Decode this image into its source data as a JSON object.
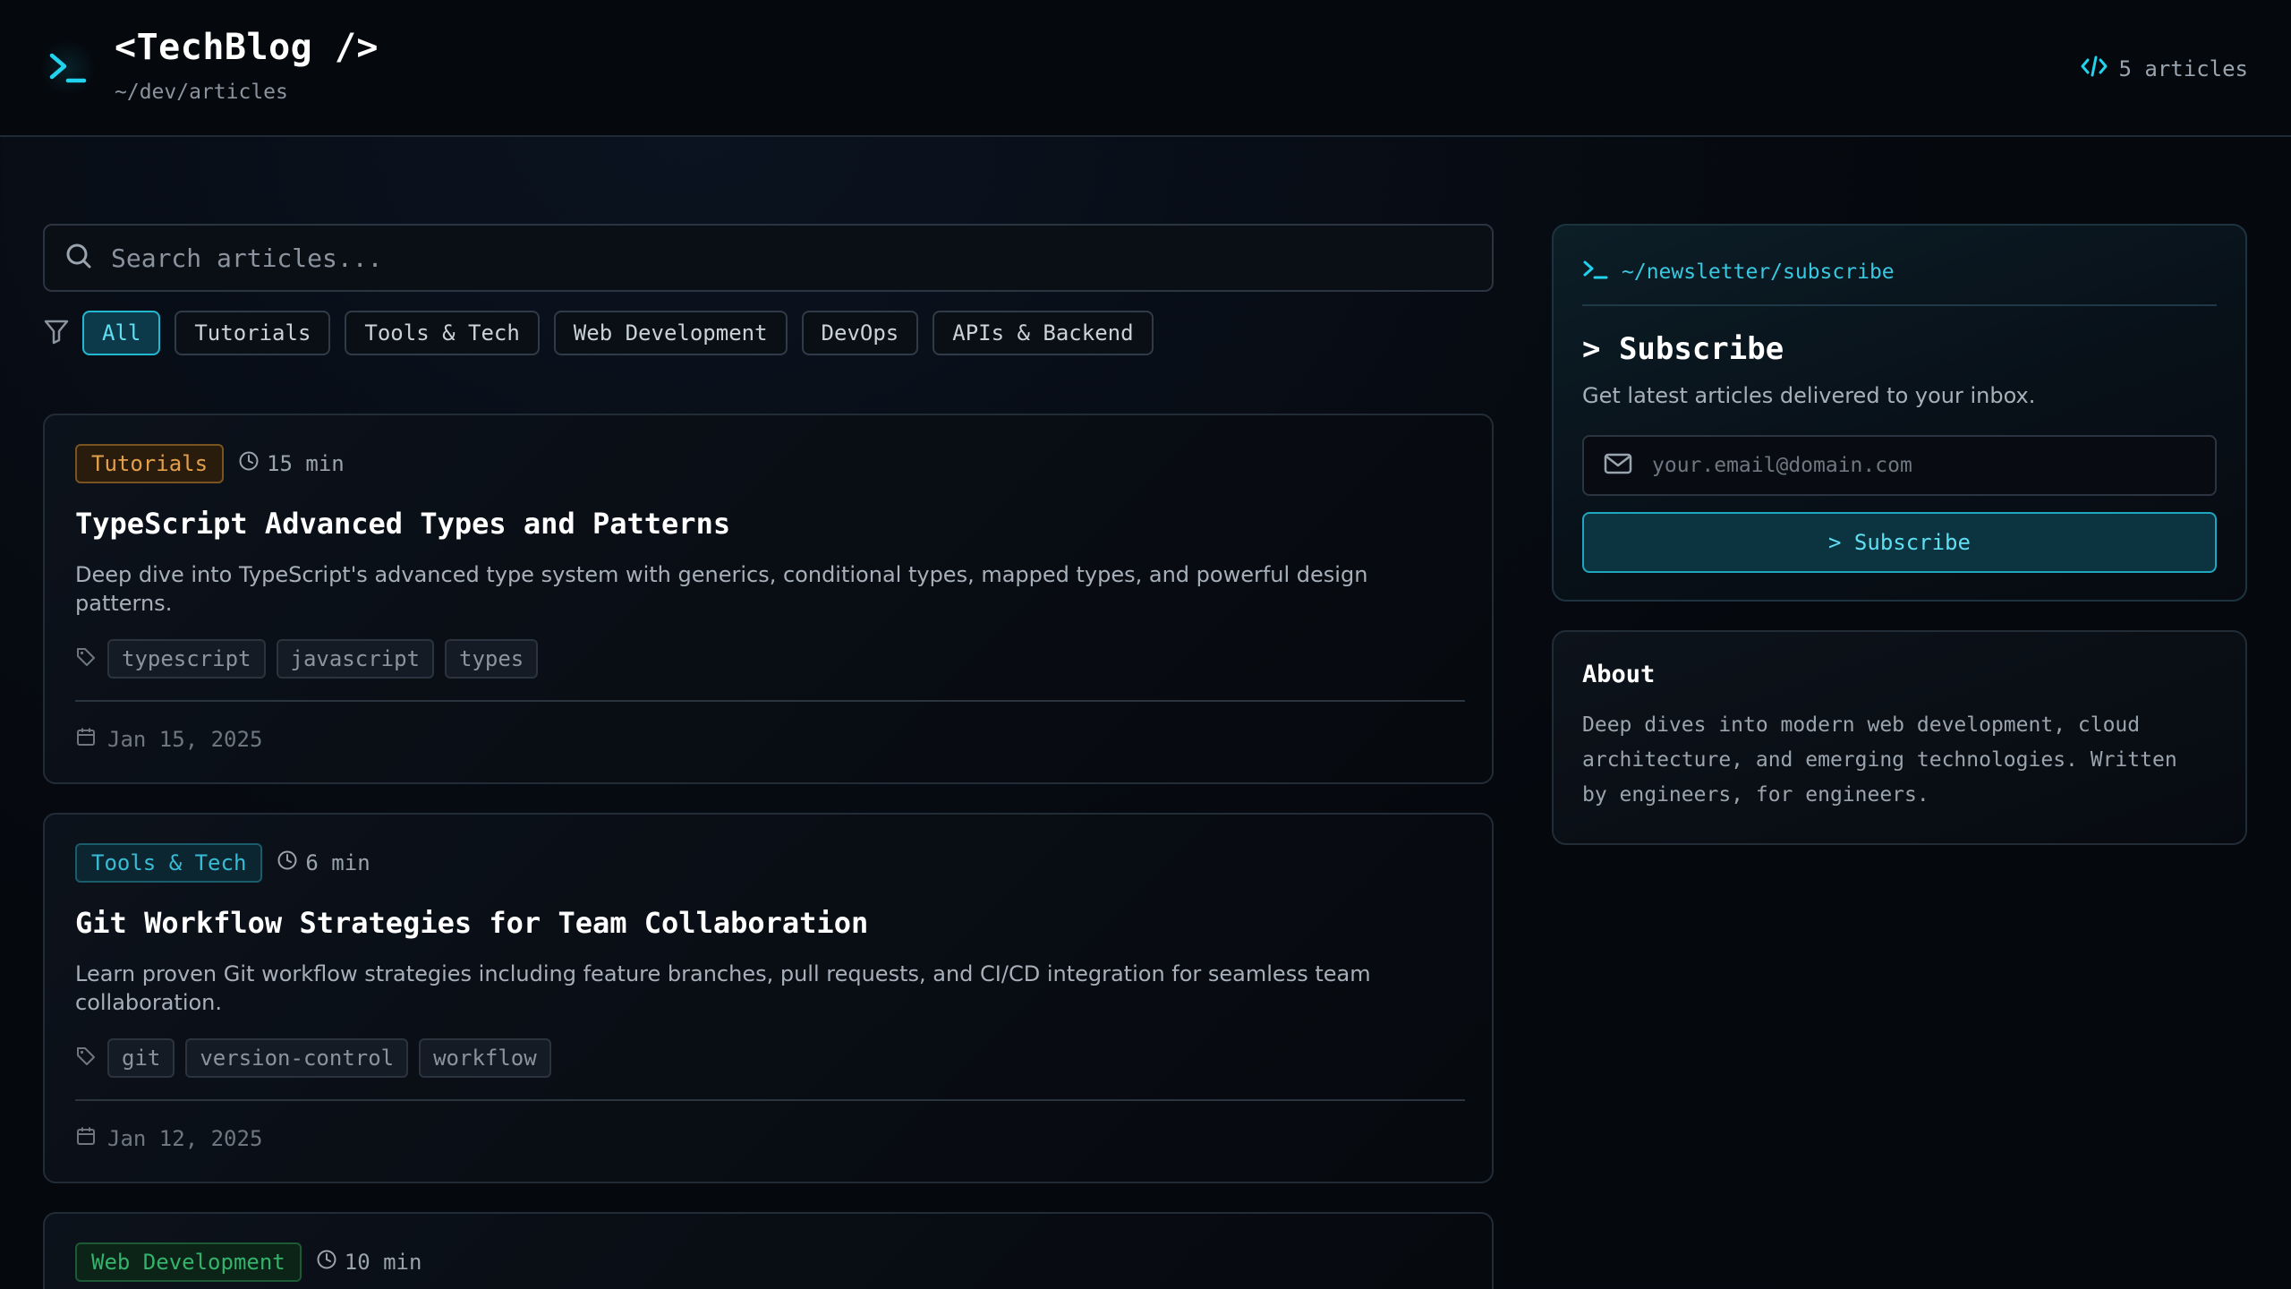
{
  "header": {
    "title": "<TechBlog />",
    "subtitle": "~/dev/articles",
    "article_count": "5 articles"
  },
  "search": {
    "placeholder": "Search articles..."
  },
  "filters": {
    "items": [
      {
        "label": "All",
        "active": true
      },
      {
        "label": "Tutorials",
        "active": false
      },
      {
        "label": "Tools & Tech",
        "active": false
      },
      {
        "label": "Web Development",
        "active": false
      },
      {
        "label": "DevOps",
        "active": false
      },
      {
        "label": "APIs & Backend",
        "active": false
      }
    ]
  },
  "articles": [
    {
      "category": "Tutorials",
      "category_color": "#e3a04a",
      "read_time": "15 min",
      "title": "TypeScript Advanced Types and Patterns",
      "description": "Deep dive into TypeScript's advanced type system with generics, conditional types, mapped types, and powerful design patterns.",
      "tags": [
        "typescript",
        "javascript",
        "types"
      ],
      "date": "Jan 15, 2025"
    },
    {
      "category": "Tools & Tech",
      "category_color": "#38bcd6",
      "read_time": "6 min",
      "title": "Git Workflow Strategies for Team Collaboration",
      "description": "Learn proven Git workflow strategies including feature branches, pull requests, and CI/CD integration for seamless team collaboration.",
      "tags": [
        "git",
        "version-control",
        "workflow"
      ],
      "date": "Jan 12, 2025"
    },
    {
      "category": "Web Development",
      "category_color": "#34b36b",
      "read_time": "10 min"
    }
  ],
  "newsletter": {
    "path": "~/newsletter/subscribe",
    "title": "> Subscribe",
    "description": "Get latest articles delivered to your inbox.",
    "email_placeholder": "your.email@domain.com",
    "button_label": "> Subscribe"
  },
  "about": {
    "title": "About",
    "text_lines": [
      "Deep dives into modern web development, cloud",
      "architecture, and emerging technologies. Written",
      "by engineers, for engineers."
    ]
  },
  "colors": {
    "accent": "#22d3ee",
    "background": "#05080d"
  }
}
